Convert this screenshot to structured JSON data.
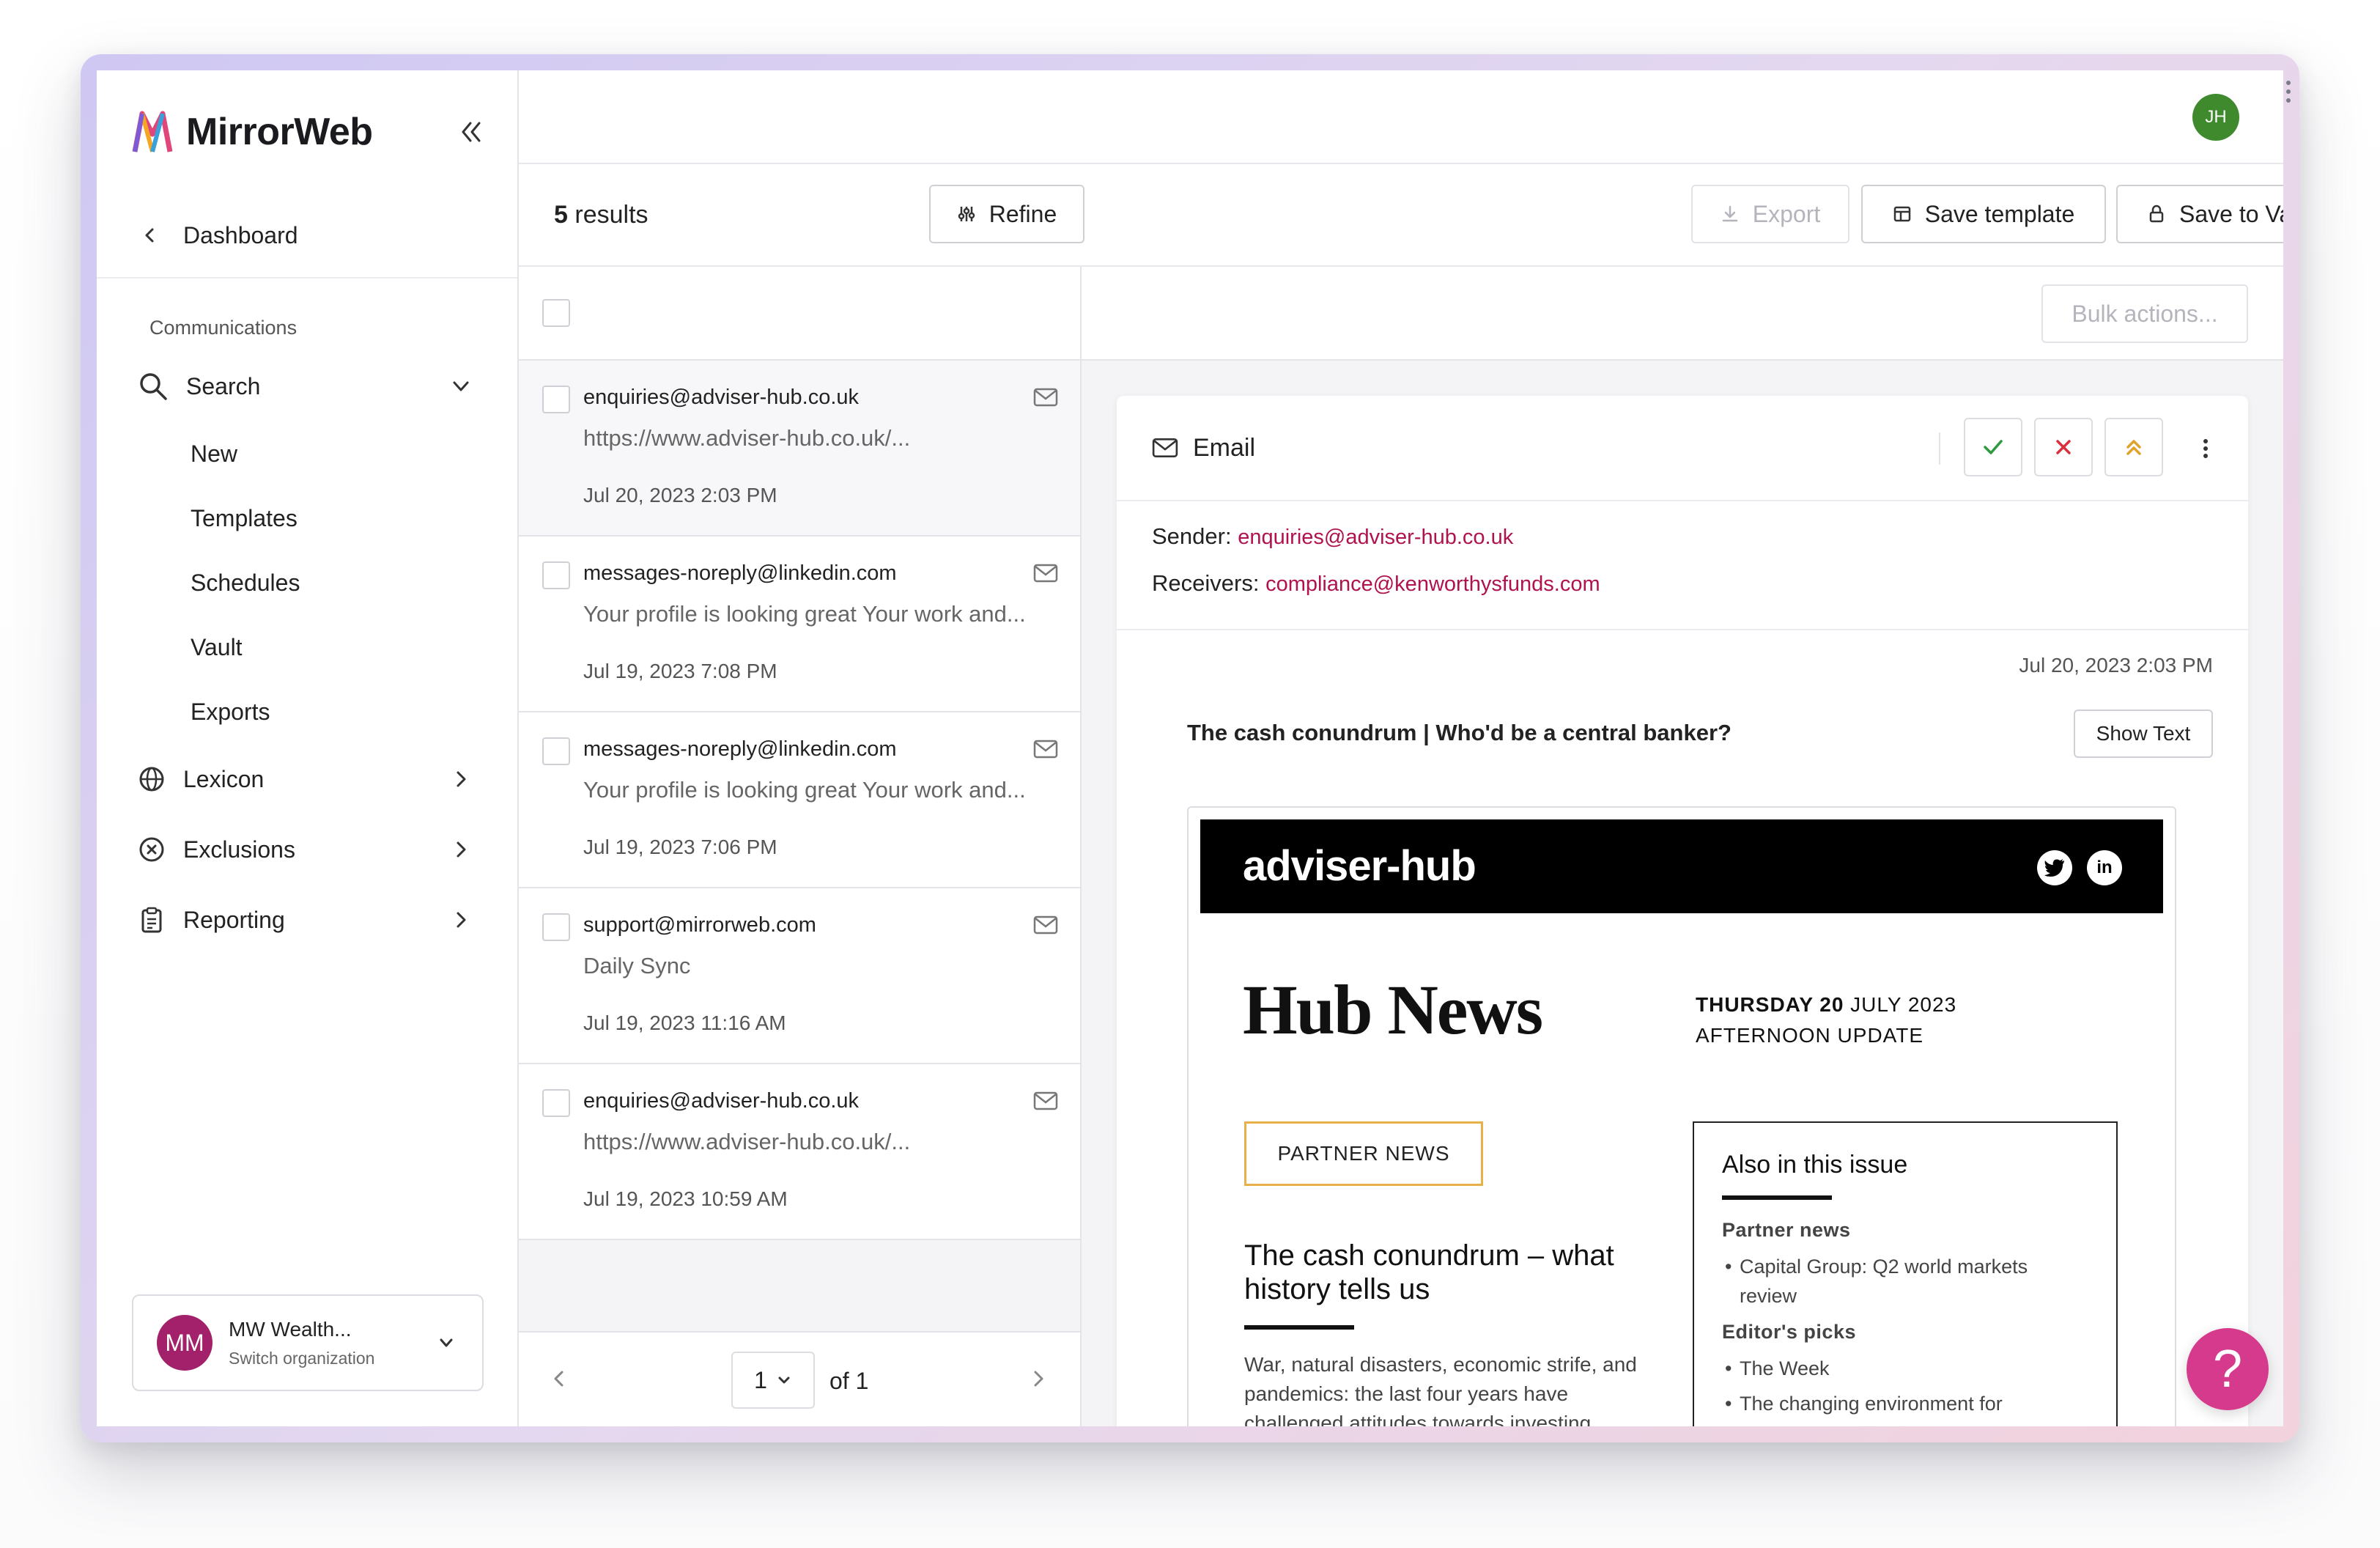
{
  "app": {
    "brand": "MirrorWeb",
    "user_initials": "JH",
    "colors": {
      "accent_pink": "#d63a8c",
      "link": "#b0124f",
      "avatar_green": "#3e8a2c",
      "org_purple": "#a3206b"
    }
  },
  "sidebar": {
    "dashboard_label": "Dashboard",
    "section_label": "Communications",
    "search_label": "Search",
    "search_subitems": [
      "New",
      "Templates",
      "Schedules",
      "Vault",
      "Exports"
    ],
    "lexicon_label": "Lexicon",
    "exclusions_label": "Exclusions",
    "reporting_label": "Reporting",
    "org": {
      "initials": "MM",
      "name": "MW Wealth...",
      "sub": "Switch organization"
    }
  },
  "toolbar": {
    "results_count": "5",
    "results_suffix": " results",
    "refine_label": "Refine",
    "export_label": "Export",
    "save_template_label": "Save template",
    "save_vault_label": "Save to Vault",
    "bulk_actions_label": "Bulk actions..."
  },
  "emails": [
    {
      "from": "enquiries@adviser-hub.co.uk",
      "preview": "https://www.adviser-hub.co.uk/...",
      "date": "Jul 20, 2023 2:03 PM"
    },
    {
      "from": "messages-noreply@linkedin.com",
      "preview": "Your profile is looking great Your work and...",
      "date": "Jul 19, 2023 7:08 PM"
    },
    {
      "from": "messages-noreply@linkedin.com",
      "preview": "Your profile is looking great Your work and...",
      "date": "Jul 19, 2023 7:06 PM"
    },
    {
      "from": "support@mirrorweb.com",
      "preview": "Daily Sync",
      "date": "Jul 19, 2023 11:16 AM"
    },
    {
      "from": "enquiries@adviser-hub.co.uk",
      "preview": "https://www.adviser-hub.co.uk/...",
      "date": "Jul 19, 2023 10:59 AM"
    }
  ],
  "pager": {
    "current": "1",
    "of_label": "of 1"
  },
  "detail": {
    "type_label": "Email",
    "sender_label": "Sender:",
    "sender": "enquiries@adviser-hub.co.uk",
    "receivers_label": "Receivers:",
    "receivers": "compliance@kenworthysfunds.com",
    "date": "Jul 20, 2023 2:03 PM",
    "subject": "The cash conundrum | Who'd be a central banker?",
    "show_text_label": "Show Text"
  },
  "newsletter": {
    "brand": "adviser-hub",
    "title": "Hub News",
    "date_bold": "THURSDAY 20",
    "date_rest": " JULY 2023",
    "edition": "AFTERNOON UPDATE",
    "tag": "PARTNER NEWS",
    "headline": "The cash conundrum – what history tells us",
    "body": "War, natural disasters, economic strife, and pandemics: the last four years have challenged attitudes towards investing",
    "box_title": "Also in this issue",
    "box_sections": [
      {
        "heading": "Partner news",
        "items": [
          "Capital Group: Q2 world markets review"
        ]
      },
      {
        "heading": "Editor's picks",
        "items": [
          "The Week",
          "The changing environment for"
        ]
      }
    ]
  },
  "help_label": "?"
}
